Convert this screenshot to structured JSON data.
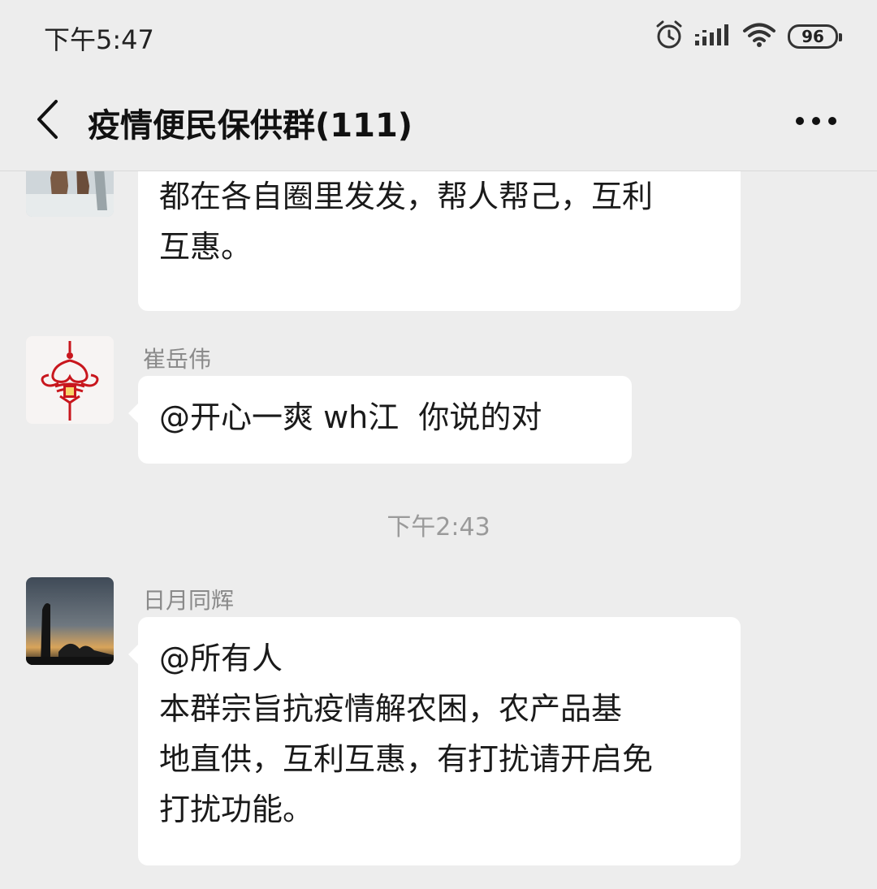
{
  "status_bar": {
    "time": "下午5:47",
    "battery": "96",
    "icons": [
      "alarm-icon",
      "signal-icon",
      "wifi-icon",
      "battery-icon"
    ]
  },
  "title_bar": {
    "title": "疫情便民保供群(111)",
    "back_icon": "chevron-left-icon",
    "more_icon": "more-icon"
  },
  "messages": [
    {
      "sender": "",
      "text": "都在各自圈里发发，帮人帮己，互利\n互惠。"
    },
    {
      "sender": "崔岳伟",
      "text": "@开心一爽 wh江  你说的对"
    },
    {
      "type": "time",
      "text": "下午2:43"
    },
    {
      "sender": "日月同辉",
      "text": "@所有人\n本群宗旨抗疫情解农困，农产品基\n地直供，互利互惠，有打扰请开启免\n打扰功能。"
    }
  ],
  "colors": {
    "background": "#ededed",
    "bubble": "#ffffff",
    "name_text": "#8a8a8a",
    "knot_red": "#c8161d"
  }
}
